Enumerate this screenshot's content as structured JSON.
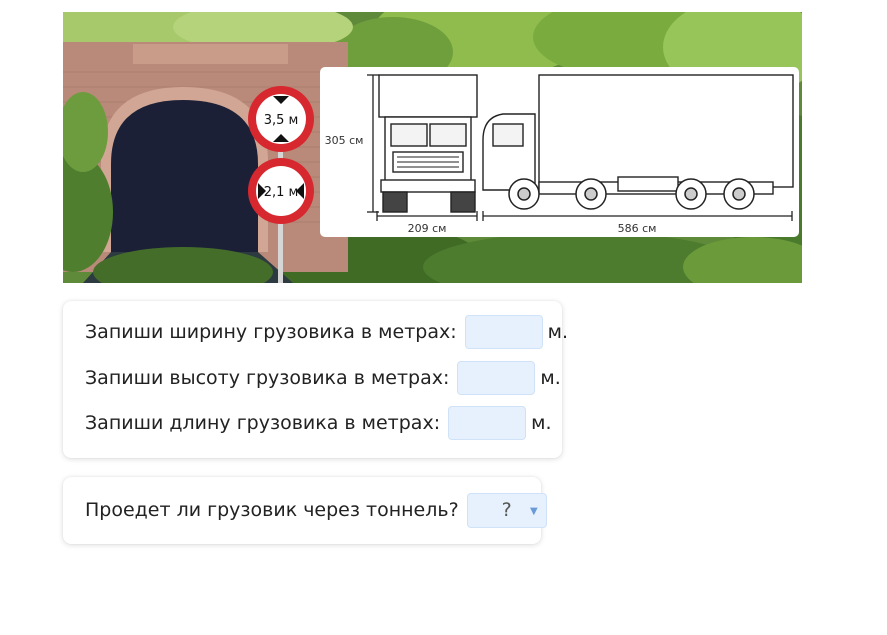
{
  "scene": {
    "sign_height": "3,5 м",
    "sign_width": "2,1 м",
    "dim_height": "305 см",
    "dim_width": "209 см",
    "dim_length": "586 см"
  },
  "questions": [
    {
      "text": "Запиши ширину грузовика в метрах:",
      "unit": "м."
    },
    {
      "text": "Запиши высоту грузовика в метрах:",
      "unit": "м."
    },
    {
      "text": "Запиши длину грузовика в метрах:",
      "unit": "м."
    }
  ],
  "pass_question": {
    "text": "Проедет ли грузовик через тоннель?",
    "select_value": "?"
  }
}
